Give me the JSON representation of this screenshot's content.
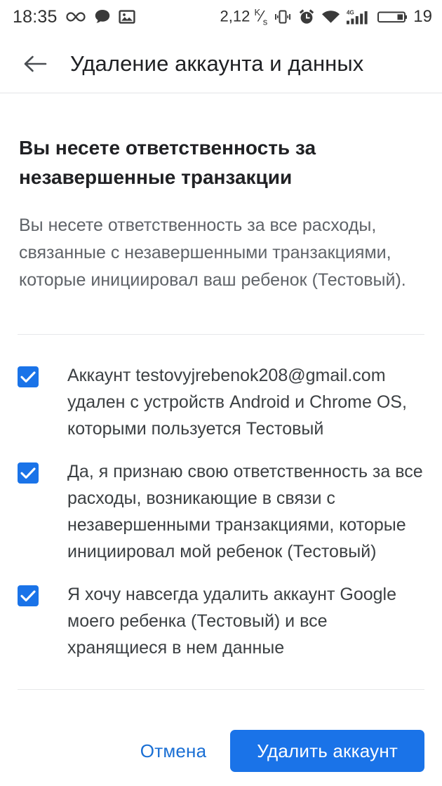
{
  "status_bar": {
    "time": "18:35",
    "left_icons": [
      "infinity-icon",
      "chat-bubble-icon",
      "photo-icon"
    ],
    "data_rate": "2,12",
    "data_rate_unit_top": "K",
    "data_rate_unit_bottom": "s",
    "right_icons": [
      "vibrate-icon",
      "alarm-icon",
      "wifi-icon",
      "signal-4g-icon",
      "battery-icon"
    ],
    "network_type": "4G",
    "battery_level": "19"
  },
  "app_bar": {
    "back_icon": "arrow-back-icon",
    "title": "Удаление аккаунта и данных"
  },
  "main": {
    "headline": "Вы несете ответственность за незавершенные транзакции",
    "body": "Вы несете ответственность за все расходы, связанные с незавершенными транзакциями, которые инициировал ваш ребенок (Тестовый).",
    "checkboxes": [
      {
        "label": "Аккаунт testovyjrebenok208@gmail.com удален с устройств Android и Chrome OS, которыми пользуется Тестовый",
        "checked": true
      },
      {
        "label": "Да, я признаю свою ответственность за все расходы, возникающие в связи с незавершенными транзакциями, которые инициировал мой ребенок (Тестовый)",
        "checked": true
      },
      {
        "label": "Я хочу навсегда удалить аккаунт Google моего ребенка (Тестовый) и все хранящиеся в нем данные",
        "checked": true
      }
    ]
  },
  "actions": {
    "cancel_label": "Отмена",
    "confirm_label": "Удалить аккаунт"
  },
  "colors": {
    "accent": "#1a73e8",
    "title_text": "#202124",
    "body_text": "#5f6368",
    "divider": "#e6e8ea"
  }
}
